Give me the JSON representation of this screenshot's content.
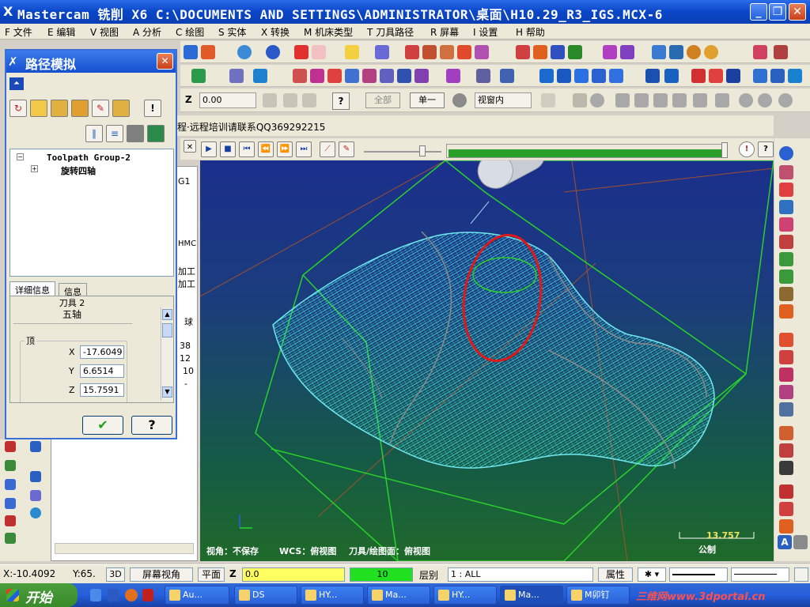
{
  "window": {
    "title": "Mastercam 铣削 X6  C:\\DOCUMENTS AND SETTINGS\\ADMINISTRATOR\\桌面\\H10.29_R3_IGS.MCX-6",
    "app_icon": "X"
  },
  "menu": [
    "F 文件",
    "E 编辑",
    "V 视图",
    "A 分析",
    "C 绘图",
    "S 实体",
    "X 转换",
    "M 机床类型",
    "T 刀具路径",
    "R 屏幕",
    "I 设置",
    "H 帮助"
  ],
  "toolbar3": {
    "z_label": "Z",
    "z_value": "0.00",
    "all_btn": "全部",
    "single_btn": "单一",
    "view_select": "视窗内"
  },
  "promo_text": "程·远程培训请联系QQ369292215",
  "dialog": {
    "title": "路径模拟",
    "tree": {
      "group": "Toolpath Group-2",
      "item": "旋转四轴"
    },
    "tabs": [
      "详细信息",
      "信息"
    ],
    "tool_line": "刀具 2",
    "axis_line": "五轴",
    "section": "顶",
    "coords": [
      {
        "axis": "X",
        "value": "-17.6049"
      },
      {
        "axis": "Y",
        "value": "6.6514"
      },
      {
        "axis": "Z",
        "value": "15.7591"
      }
    ]
  },
  "side_panel_fragments": [
    "G1",
    "HMC",
    "加工",
    "加工",
    "球",
    "38",
    "12",
    "10",
    "-"
  ],
  "viewport": {
    "bottom_labels": {
      "view": "视角：不保存",
      "wcs": "WCS：俯视图",
      "tool_plane": "刀具/绘图面：俯视图"
    },
    "scale_value": "13.757",
    "scale_unit": "公制"
  },
  "status_bar": {
    "x": "X:-10.4092",
    "y": "Y:65.",
    "mode_3d": "3D",
    "screen_view": "屏幕视角",
    "plane": "平面",
    "z_label": "Z",
    "z_value": "0.0",
    "level_value": "10",
    "level_label": "层别",
    "level_select": "1 : ALL",
    "attr": "属性"
  },
  "taskbar": {
    "start": "开始",
    "tasks": [
      "Au...",
      "DS",
      "HY...",
      "Ma...",
      "HY...",
      "Ma...",
      "M卯钉"
    ],
    "watermark": "三维网www.3dportal.cn"
  }
}
